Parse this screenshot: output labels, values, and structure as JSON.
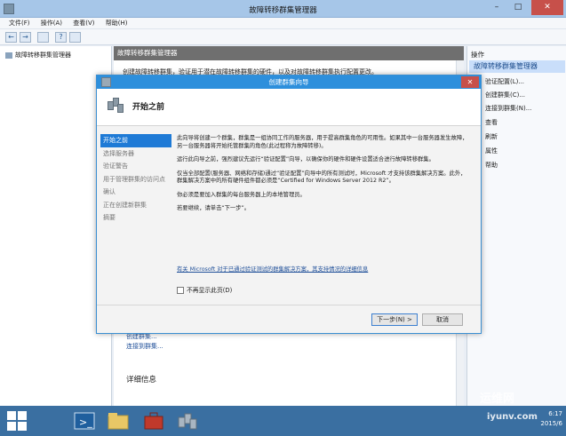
{
  "window": {
    "title": "故障转移群集管理器",
    "minimize": "–",
    "maximize": "□",
    "close": "✕"
  },
  "menu": [
    "文件(F)",
    "操作(A)",
    "查看(V)",
    "帮助(H)"
  ],
  "toolbar": {
    "back": "←",
    "forward": "→",
    "help": "?"
  },
  "tree": {
    "root": "故障转移群集管理器"
  },
  "center": {
    "header": "故障转移群集管理器",
    "intro": "创建故障转移群集，验证用于潜在故障转移群集的硬件，以及对故障转移群集执行配置更改。",
    "link_create": "创建群集...",
    "link_connect": "连接到群集...",
    "detail": "详细信息"
  },
  "actions": {
    "header": "操作",
    "selected": "故障转移群集管理器",
    "items": [
      "验证配置(L)...",
      "创建群集(C)...",
      "连接到群集(N)...",
      "查看",
      "刷新",
      "属性",
      "帮助"
    ]
  },
  "dialog": {
    "title": "创建群集向导",
    "close": "✕",
    "heading": "开始之前",
    "nav": [
      "开始之前",
      "选择服务器",
      "验证警告",
      "用于管理群集的访问点",
      "确认",
      "正在创建新群集",
      "摘要"
    ],
    "paragraphs": [
      "此向导将创建一个群集，群集是一组协同工作的服务器，用于提高群集角色的可用性。如果其中一台服务器发生故障，另一台服务器将开始托管群集的角色(此过程称为故障转移)。",
      "运行此向导之前，强烈建议先运行“验证配置”向导，以确保你的硬件和硬件设置适合进行故障转移群集。",
      "仅当全部配置(服务器、网络和存储)通过“验证配置”向导中的所有测试时，Microsoft 才支持该群集解决方案。此外，群集解决方案中的所有硬件组件都必须是“Certified for Windows Server 2012 R2”。",
      "你必须是要加入群集的每台服务器上的本地管理员。",
      "若要继续，请单击“下一步”。"
    ],
    "support_link": "有关 Microsoft 对于已通过验证测试的群集解决方案，其支持情况的详细信息",
    "checkbox_label": "不再显示此页(D)",
    "next_button": "下一步(N) >",
    "cancel_button": "取消"
  },
  "taskbar": {
    "time": "6:17",
    "date": "2015/6"
  },
  "watermark": {
    "brand": "运维网",
    "url": "iyunv.com"
  }
}
